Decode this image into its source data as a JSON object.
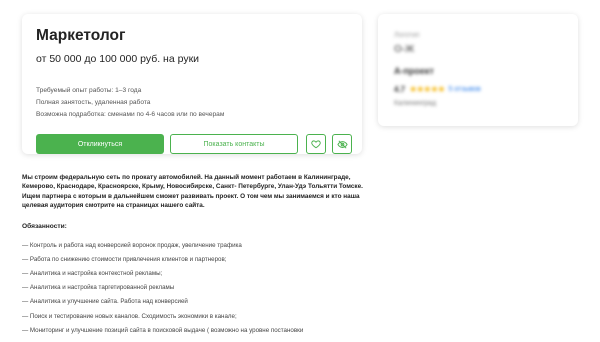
{
  "vacancy": {
    "title": "Маркетолог",
    "salary": "от 50 000 до 100 000 руб. на руки",
    "experience": "Требуемый опыт работы: 1–3 года",
    "employment": "Полная занятость, удаленная работа",
    "shift": "Возможна подработка: сменами по 4-6 часов или по вечерам",
    "respond_label": "Откликнуться",
    "contacts_label": "Показать контакты",
    "favorite_icon": "heart-icon",
    "hide_icon": "eye-off-icon",
    "accent_color": "#4bb24e"
  },
  "employer": {
    "logo_text": "Логотип",
    "logo_sub": "О-Ж",
    "name": "А-проект",
    "rating": "4.7",
    "stars": "★★★★★",
    "reviews": "5 отзывов",
    "location": "Калининград"
  },
  "description": {
    "intro": "Мы строим федеральную сеть по прокату автомобилей. На данный момент работаем в Калининграде, Кемерово, Краснодаре, Красноярске, Крыму, Новосибирске, Санкт- Петербурге, Улан-Удэ Тольятти Томске.",
    "partner": "Ищем партнера с которым в дальнейшем сможет развивать проект. О том чем мы занимаемся и кто наша целевая аудитория смотрите на страницах нашего сайта.",
    "duties_heading": "Обязанности:",
    "duties": [
      "— Контроль и работа над конверсией воронок продаж, увеличение трафика",
      "— Работа по снижению стоимости привлечения клиентов и партнеров;",
      "— Аналитика и настройка контекстной рекламы;",
      "— Аналитика и настройка таргетированной рекламы",
      "— Аналитика и улучшение сайта. Работа над конверсией",
      "— Поиск и тестирование новых каналов. Сходимость экономики в канале;",
      "— Мониторинг и улучшение позиций сайта в поисковой выдаче ( возможно на уровне постановки"
    ]
  }
}
